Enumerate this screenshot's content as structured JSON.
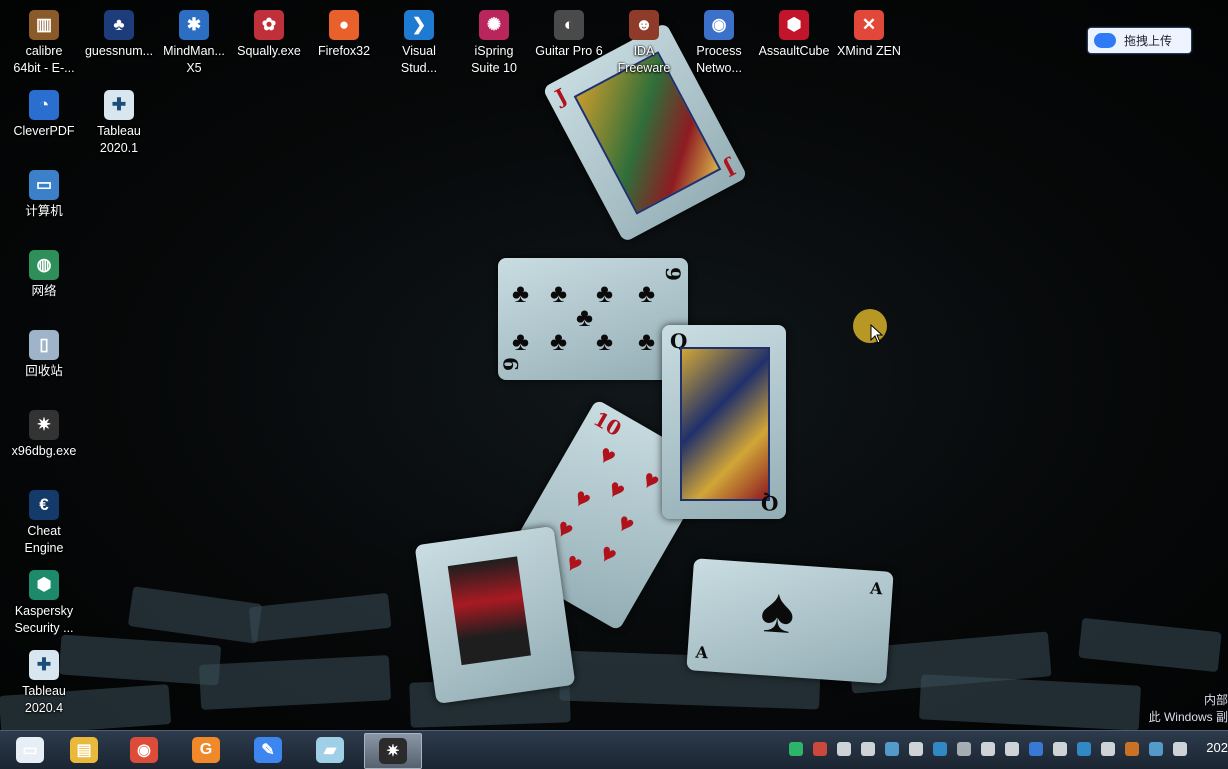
{
  "desktop_icons": [
    {
      "label": "calibre\n64bit - E-...",
      "icon": "calibre-icon",
      "color": "#8b5a2b",
      "glyph": "▥"
    },
    {
      "label": "guessnum...",
      "icon": "guessnum-icon",
      "color": "#1c3d7a",
      "glyph": "♣"
    },
    {
      "label": "MindMan...\nX5",
      "icon": "mindmanager-icon",
      "color": "#2c6fc2",
      "glyph": "✱"
    },
    {
      "label": "Squally.exe",
      "icon": "squally-icon",
      "color": "#c0303a",
      "glyph": "✿"
    },
    {
      "label": "Firefox32",
      "icon": "firefox-icon",
      "color": "#e8602c",
      "glyph": "●"
    },
    {
      "label": "Visual\nStud...",
      "icon": "vscode-icon",
      "color": "#1f7ad1",
      "glyph": "❯"
    },
    {
      "label": "iSpring\nSuite 10",
      "icon": "ispring-icon",
      "color": "#b9265c",
      "glyph": "✺"
    },
    {
      "label": "Guitar Pro 6",
      "icon": "guitarpro-icon",
      "color": "#4a4a4a",
      "glyph": "◐"
    },
    {
      "label": "IDA\nFreeware",
      "icon": "ida-icon",
      "color": "#8f3b2a",
      "glyph": "☻"
    },
    {
      "label": "Process\nNetwo...",
      "icon": "process-network-icon",
      "color": "#3b71c8",
      "glyph": "◉"
    },
    {
      "label": "AssaultCube",
      "icon": "assaultcube-icon",
      "color": "#c2142b",
      "glyph": "⬢"
    },
    {
      "label": "XMind ZEN",
      "icon": "xmind-icon",
      "color": "#e2483a",
      "glyph": "✕"
    },
    {
      "label": "CleverPDF",
      "icon": "cleverpdf-icon",
      "color": "#2a6fd0",
      "glyph": "◔"
    },
    {
      "label": "Tableau\n2020.1",
      "icon": "tableau-icon",
      "color": "#d8e6ef",
      "glyph": "✚"
    },
    {
      "label": "计算机",
      "icon": "computer-icon",
      "color": "#3b80c8",
      "glyph": "▭"
    },
    {
      "label": "网络",
      "icon": "network-icon",
      "color": "#2f8f5a",
      "glyph": "◍"
    },
    {
      "label": "回收站",
      "icon": "recycle-bin-icon",
      "color": "#9fb4c8",
      "glyph": "▯"
    },
    {
      "label": "x96dbg.exe",
      "icon": "x96dbg-icon",
      "color": "#333333",
      "glyph": "✷"
    },
    {
      "label": "Cheat\nEngine",
      "icon": "cheat-engine-icon",
      "color": "#143a6a",
      "glyph": "€"
    },
    {
      "label": "Kaspersky\nSecurity ...",
      "icon": "kaspersky-icon",
      "color": "#1c8a6b",
      "glyph": "⬢"
    },
    {
      "label": "Tableau\n2020.4",
      "icon": "tableau-icon",
      "color": "#d8e6ef",
      "glyph": "✚"
    }
  ],
  "upload_button": {
    "label": "拖拽上传"
  },
  "watermark": {
    "line1": "内部",
    "line2": "此 Windows 副"
  },
  "taskbar": {
    "apps": [
      {
        "name": "show-desktop-icon",
        "glyph": "▭",
        "color": "#e8eef5"
      },
      {
        "name": "file-explorer-icon",
        "glyph": "▤",
        "color": "#e9b93b"
      },
      {
        "name": "chrome-icon",
        "glyph": "◉",
        "color": "#dd4b39"
      },
      {
        "name": "foxit-pdf-icon",
        "glyph": "G",
        "color": "#f0892a"
      },
      {
        "name": "notes-app-icon",
        "glyph": "✎",
        "color": "#3d86f0"
      },
      {
        "name": "notepad-icon",
        "glyph": "▰",
        "color": "#9fd0e8"
      },
      {
        "name": "x96dbg-taskbar-icon",
        "glyph": "✷",
        "color": "#2b2b2b"
      }
    ],
    "clock": "202"
  },
  "colors": {
    "accent": "#2f7bf6",
    "taskbar": "#1b2532"
  }
}
